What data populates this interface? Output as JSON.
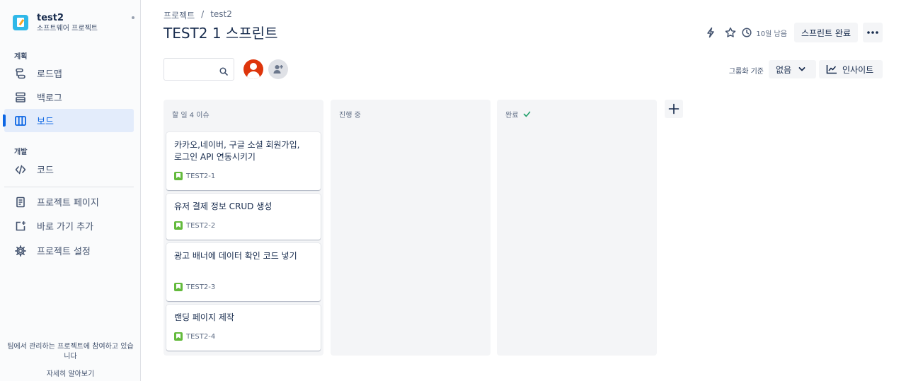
{
  "sidebar": {
    "project_name": "test2",
    "project_type": "소프트웨어 프로젝트",
    "section_plan": "계획",
    "section_dev": "개발",
    "items": [
      {
        "label": "로드맵"
      },
      {
        "label": "백로그"
      },
      {
        "label": "보드"
      },
      {
        "label": "코드"
      },
      {
        "label": "프로젝트 페이지"
      },
      {
        "label": "바로 가기 추가"
      },
      {
        "label": "프로젝트 설정"
      }
    ],
    "footer_text": "팀에서 관리하는 프로젝트에 참여하고 있습니다",
    "footer_link": "자세히 알아보기"
  },
  "header": {
    "breadcrumb": [
      "프로젝트",
      "test2"
    ],
    "breadcrumb_sep": "/",
    "title": "TEST2 1 스프린트",
    "days_left": "10일 남음",
    "complete_sprint": "스프린트 완료"
  },
  "toolbar": {
    "search_value": "",
    "group_by_label": "그룹화 기준",
    "group_by_value": "없음",
    "insights_label": "인사이트"
  },
  "board": {
    "columns": [
      {
        "title": "할 일 4 이슈",
        "cards": [
          {
            "title": "카카오,네이버, 구글 소셜 회원가입, 로그인 API 연동시키기",
            "key": "TEST2-1"
          },
          {
            "title": "유저 결제 정보 CRUD 생성",
            "key": "TEST2-2"
          },
          {
            "title": "광고 배너에 데이터 확인 코드 넣기",
            "key": "TEST2-3"
          },
          {
            "title": "랜딩 페이지 제작",
            "key": "TEST2-4"
          }
        ]
      },
      {
        "title": "진행 중",
        "cards": []
      },
      {
        "title": "완료",
        "cards": []
      }
    ]
  },
  "colors": {
    "accent": "#0c66e4",
    "story": "#63ba3c",
    "avatar": "#de350b",
    "column_bg": "#f4f5f7"
  }
}
